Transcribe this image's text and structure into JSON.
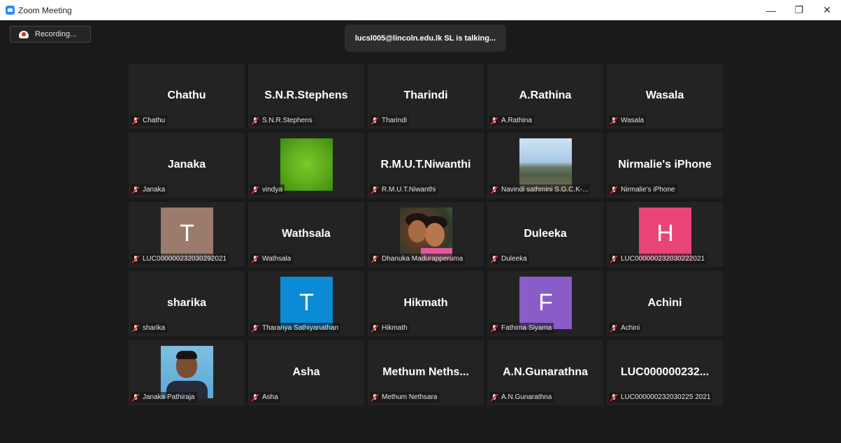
{
  "window": {
    "title": "Zoom Meeting"
  },
  "colors": {
    "accent": "#2d8cff",
    "muted": "#e02828",
    "background": "#1a1a1a",
    "tile": "#232323"
  },
  "recording": {
    "label": "Recording..."
  },
  "talking": {
    "text": "lucsl005@lincoln.edu.lk SL is talking..."
  },
  "tiles": [
    {
      "type": "name",
      "name": "Chathu",
      "label": "Chathu"
    },
    {
      "type": "name",
      "name": "S.N.R.Stephens",
      "label": "S.N.R.Stephens"
    },
    {
      "type": "name",
      "name": "Tharindi",
      "label": "Tharindi"
    },
    {
      "type": "name",
      "name": "A.Rathina",
      "label": "A.Rathina"
    },
    {
      "type": "name",
      "name": "Wasala",
      "label": "Wasala"
    },
    {
      "type": "name",
      "name": "Janaka",
      "label": "Janaka"
    },
    {
      "type": "photo",
      "photo": "green-photo",
      "label": "vindya"
    },
    {
      "type": "name",
      "name": "R.M.U.T.Niwanthi",
      "label": "R.M.U.T.Niwanthi"
    },
    {
      "type": "photo",
      "photo": "landscape-photo",
      "label": "Navindi sathmini S.G.C.K-..."
    },
    {
      "type": "name",
      "name": "Nirmalie's iPhone",
      "label": "Nirmalie's iPhone"
    },
    {
      "type": "letter",
      "letter": "T",
      "color": "#9b7b6b",
      "label": "LUC000000232030292021"
    },
    {
      "type": "name",
      "name": "Wathsala",
      "label": "Wathsala"
    },
    {
      "type": "photo",
      "photo": "girls-photo",
      "label": "Dhanuka Madurapperuma"
    },
    {
      "type": "name",
      "name": "Duleeka",
      "label": "Duleeka"
    },
    {
      "type": "letter",
      "letter": "H",
      "color": "#e84478",
      "label": "LUC000000232030222021"
    },
    {
      "type": "name",
      "name": "sharika",
      "label": "sharika"
    },
    {
      "type": "letter",
      "letter": "T",
      "color": "#0b8ad6",
      "label": "Tharanya Sathiyanathan"
    },
    {
      "type": "name",
      "name": "Hikmath",
      "label": "Hikmath"
    },
    {
      "type": "letter",
      "letter": "F",
      "color": "#8a5cc8",
      "label": "Fathima Siyama"
    },
    {
      "type": "name",
      "name": "Achini",
      "label": "Achini"
    },
    {
      "type": "photo",
      "photo": "man-photo",
      "label": "Janaka Pathiraja"
    },
    {
      "type": "name",
      "name": "Asha",
      "label": "Asha"
    },
    {
      "type": "name",
      "name": "Methum  Neths...",
      "label": "Methum Nethsara"
    },
    {
      "type": "name",
      "name": "A.N.Gunarathna",
      "label": "A.N.Gunarathna"
    },
    {
      "type": "name",
      "name": "LUC000000232...",
      "label": "LUC000000232030225 2021"
    }
  ]
}
